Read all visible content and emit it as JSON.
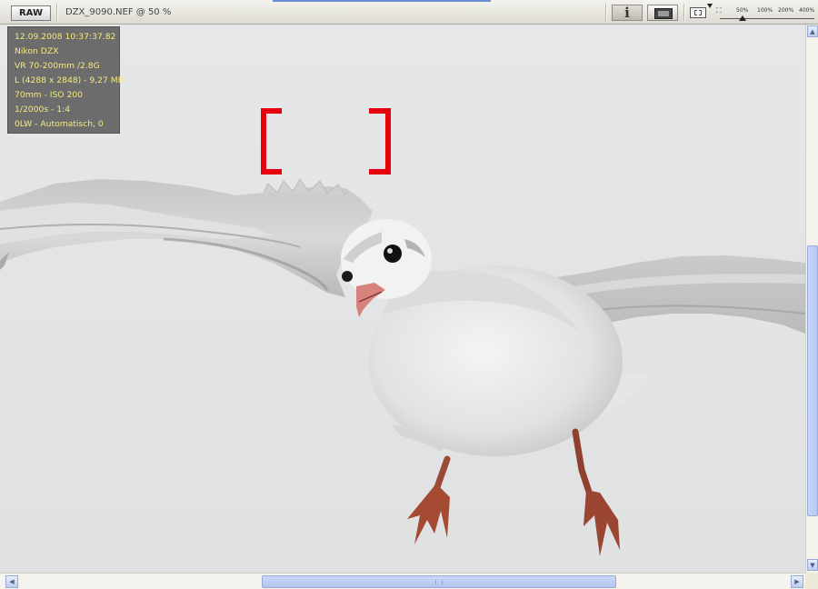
{
  "toolbar": {
    "raw_label": "RAW",
    "file_title": "DZX_9090.NEF @ 50 %",
    "info_label": "i",
    "zoom_levels": [
      "50%",
      "100%",
      "200%",
      "400%"
    ]
  },
  "exif_overlay": {
    "lines": [
      "12.09.2008 10:37:37.82",
      "Nikon DZX",
      "VR 70-200mm /2.8G",
      "L (4288 x 2848) - 9,27 MB",
      "70mm - ISO 200",
      "1/2000s - 1:4",
      "0LW - Automatisch, 0"
    ]
  },
  "colors": {
    "af_point": "#e8000f",
    "exif_text": "#f2ec7a",
    "sky": "#e4e5e6"
  }
}
